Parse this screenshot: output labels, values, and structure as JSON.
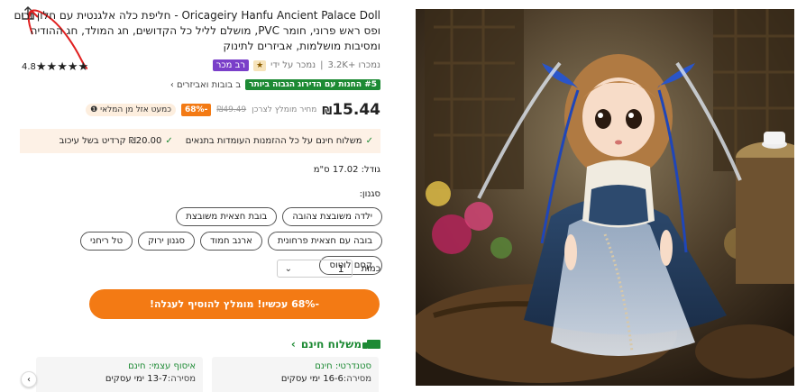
{
  "product": {
    "title": "Oricageiry Hanfu Ancient Palace Doll - חליפת כלה אלגנטית עם חלון זרים ופס ראש פרוני, חומר PVC, מושלם לליל כל הקדושים, חג המולד, חג ההודיה ומסיבות מושלמות, אביזרים לתינוק",
    "rating": "4.8",
    "sold_count": "נמכרו +3.2K",
    "sold_by": "נמכר על ידי",
    "star_badge": "★",
    "best_seller_badge": "רב מכר",
    "rank_badge": "#5 החנות עם הדירוג הגבוה ביותר",
    "rank_category": "ב בובות ואביזרים ›",
    "price": "15.44",
    "currency": "₪",
    "market_label": "מחיר מומלץ לצרכן",
    "old_price": "₪49.49",
    "discount_tag": "-68%",
    "low_stock": "כמעט אזל מן המלאי ❶"
  },
  "shipping_box": {
    "free_shipping": "משלוח חינם על כל ההזמנות העומדות בתנאים",
    "credit": "₪20.00 קרדיט בשל עיכוב"
  },
  "size": {
    "label": "גודל: 17.02 ס\"מ"
  },
  "style": {
    "label": "סגנון:",
    "options": [
      "ילדה משובצת צהובה",
      "בובת חצאית משובצת",
      "בובה עם חצאית פרחונית",
      "ארנב חמוד",
      "סגנון ירוק",
      "טל ריחני",
      "קסם לוטוס"
    ]
  },
  "quantity": {
    "label": "כמות",
    "value": "1"
  },
  "add_to_cart": "-68% עכשיו! מומלץ להוסיף לעגלה!",
  "free_ship_title": "משלוח חינם",
  "shipping_options": [
    {
      "head": "סטנדרטי: חינם",
      "sub_label": "מסירה:",
      "sub_value": "16-6 ימי עסקים"
    },
    {
      "head": "איסוף עצמי: חינם",
      "sub_label": "מסירה:",
      "sub_value": "13-7 ימי עסקים"
    }
  ],
  "accent_colors": {
    "orange": "#f37a14",
    "green": "#1d8a34",
    "annotation": "#e02020"
  }
}
